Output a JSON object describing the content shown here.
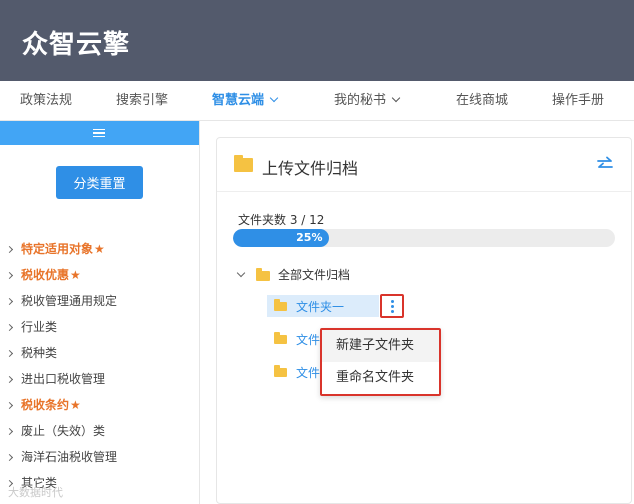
{
  "header": {
    "logo": "众智云擎"
  },
  "nav": {
    "items": [
      {
        "label": "政策法规"
      },
      {
        "label": "搜索引擎"
      },
      {
        "label": "智慧云端"
      },
      {
        "label": "我的秘书"
      },
      {
        "label": "在线商城"
      },
      {
        "label": "操作手册"
      }
    ]
  },
  "sidebar": {
    "reset_label": "分类重置",
    "categories": [
      {
        "label": "特定适用对象"
      },
      {
        "label": "税收优惠"
      },
      {
        "label": "税收管理通用规定"
      },
      {
        "label": "行业类"
      },
      {
        "label": "税种类"
      },
      {
        "label": "进出口税收管理"
      },
      {
        "label": "税收条约"
      },
      {
        "label": "废止（失效）类"
      },
      {
        "label": "海洋石油税收管理"
      },
      {
        "label": "其它类"
      }
    ],
    "star": "★"
  },
  "card": {
    "title": "上传文件归档",
    "count_text": "文件夹数 3 / 12",
    "progress_percent": 25,
    "progress_label": "25%",
    "tree": {
      "root_label": "全部文件归档",
      "nodes": [
        {
          "label": "文件夹一"
        },
        {
          "label": "文件"
        },
        {
          "label": "文件"
        }
      ]
    },
    "menu": {
      "items": [
        {
          "label": "新建子文件夹"
        },
        {
          "label": "重命名文件夹"
        }
      ]
    }
  },
  "watermark": "大数据时代"
}
